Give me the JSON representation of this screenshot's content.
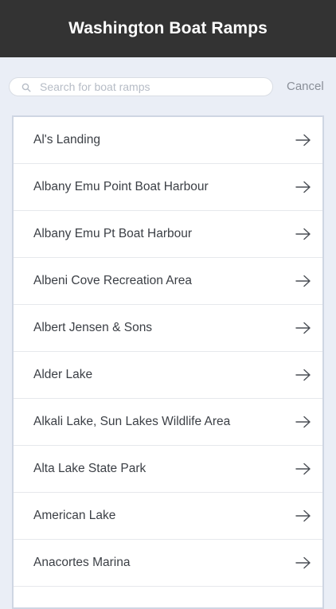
{
  "header": {
    "title": "Washington Boat Ramps"
  },
  "search": {
    "placeholder": "Search for boat ramps",
    "value": "",
    "cancel_label": "Cancel",
    "icon": "search-icon"
  },
  "list": {
    "items": [
      {
        "label": "Al's Landing"
      },
      {
        "label": "Albany Emu Point Boat Harbour"
      },
      {
        "label": "Albany Emu Pt Boat Harbour"
      },
      {
        "label": "Albeni Cove Recreation Area"
      },
      {
        "label": "Albert Jensen & Sons"
      },
      {
        "label": "Alder Lake"
      },
      {
        "label": "Alkali Lake, Sun Lakes Wildlife Area"
      },
      {
        "label": "Alta Lake State Park"
      },
      {
        "label": "American Lake"
      },
      {
        "label": "Anacortes Marina"
      }
    ],
    "item_icon": "arrow-right-icon"
  },
  "colors": {
    "header_bg": "#333333",
    "page_bg": "#eaeef6",
    "list_border": "#cfd6e3",
    "text": "#3b3f45",
    "muted": "#8a8f98"
  }
}
